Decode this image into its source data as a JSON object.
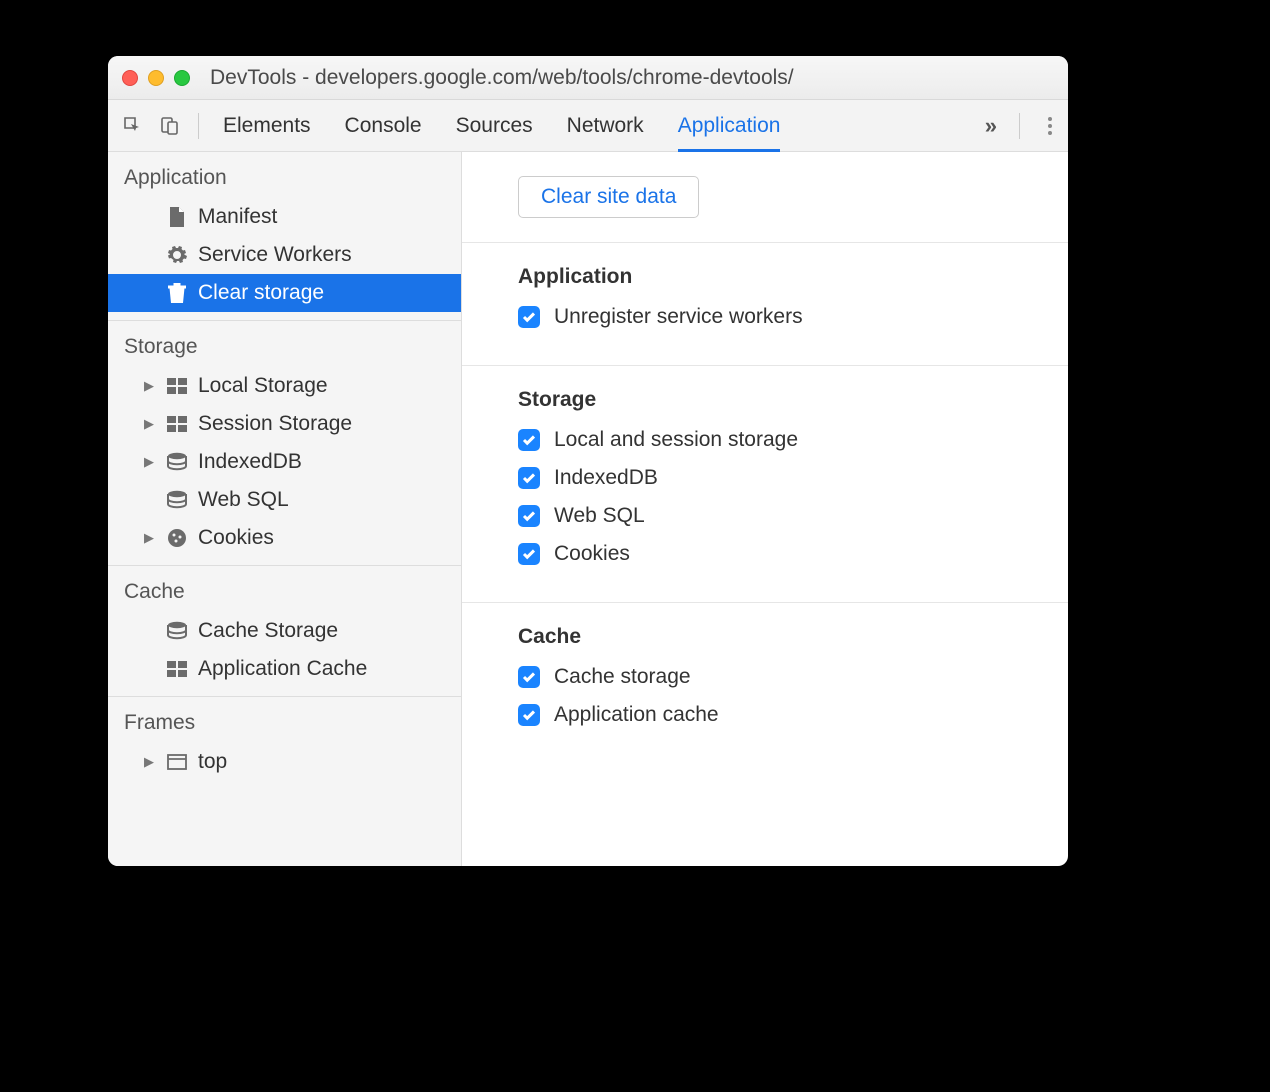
{
  "window": {
    "title": "DevTools - developers.google.com/web/tools/chrome-devtools/"
  },
  "toolbar": {
    "tabs": [
      "Elements",
      "Console",
      "Sources",
      "Network",
      "Application"
    ],
    "active_tab": "Application"
  },
  "sidebar": {
    "groups": [
      {
        "title": "Application",
        "items": [
          {
            "label": "Manifest",
            "icon": "file-icon",
            "expandable": false,
            "selected": false
          },
          {
            "label": "Service Workers",
            "icon": "gear-icon",
            "expandable": false,
            "selected": false
          },
          {
            "label": "Clear storage",
            "icon": "trash-icon",
            "expandable": false,
            "selected": true
          }
        ]
      },
      {
        "title": "Storage",
        "items": [
          {
            "label": "Local Storage",
            "icon": "grid-icon",
            "expandable": true,
            "selected": false
          },
          {
            "label": "Session Storage",
            "icon": "grid-icon",
            "expandable": true,
            "selected": false
          },
          {
            "label": "IndexedDB",
            "icon": "database-icon",
            "expandable": true,
            "selected": false
          },
          {
            "label": "Web SQL",
            "icon": "database-icon",
            "expandable": false,
            "selected": false
          },
          {
            "label": "Cookies",
            "icon": "cookie-icon",
            "expandable": true,
            "selected": false
          }
        ]
      },
      {
        "title": "Cache",
        "items": [
          {
            "label": "Cache Storage",
            "icon": "database-icon",
            "expandable": false,
            "selected": false
          },
          {
            "label": "Application Cache",
            "icon": "grid-icon",
            "expandable": false,
            "selected": false
          }
        ]
      },
      {
        "title": "Frames",
        "items": [
          {
            "label": "top",
            "icon": "frame-icon",
            "expandable": true,
            "selected": false
          }
        ]
      }
    ]
  },
  "main": {
    "clear_button": "Clear site data",
    "sections": [
      {
        "heading": "Application",
        "checks": [
          {
            "label": "Unregister service workers",
            "checked": true
          }
        ]
      },
      {
        "heading": "Storage",
        "checks": [
          {
            "label": "Local and session storage",
            "checked": true
          },
          {
            "label": "IndexedDB",
            "checked": true
          },
          {
            "label": "Web SQL",
            "checked": true
          },
          {
            "label": "Cookies",
            "checked": true
          }
        ]
      },
      {
        "heading": "Cache",
        "checks": [
          {
            "label": "Cache storage",
            "checked": true
          },
          {
            "label": "Application cache",
            "checked": true
          }
        ]
      }
    ]
  },
  "colors": {
    "accent": "#1a73e8",
    "checkbox": "#1a84ff",
    "sidebar_bg": "#f5f5f5"
  }
}
